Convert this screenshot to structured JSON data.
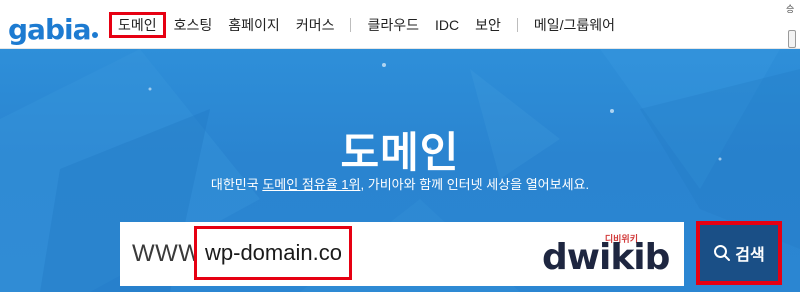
{
  "logo": {
    "text": "gabia"
  },
  "nav": {
    "items": [
      {
        "label": "도메인",
        "active": true
      },
      {
        "label": "호스팅"
      },
      {
        "label": "홈페이지"
      },
      {
        "label": "커머스"
      },
      {
        "label": "클라우드"
      },
      {
        "label": "IDC"
      },
      {
        "label": "보안"
      },
      {
        "label": "메일/그룹웨어"
      }
    ]
  },
  "edge": {
    "text": "승"
  },
  "hero": {
    "title": "도메인",
    "subtitle_before": "대한민국 ",
    "subtitle_highlight": "도메인 점유율 1위",
    "subtitle_after": ", 가비아와 함께 인터넷 세상을 열어보세요."
  },
  "search": {
    "prefix": "WWW.",
    "value": "wp-domain.com",
    "button_label": "검색"
  },
  "watermark": {
    "korean": "디비위키",
    "english": "dwikib"
  },
  "colors": {
    "brand": "#1d7bd1",
    "hero": "#2b86d2",
    "button": "#1a4f86",
    "highlight": "#e60012"
  }
}
